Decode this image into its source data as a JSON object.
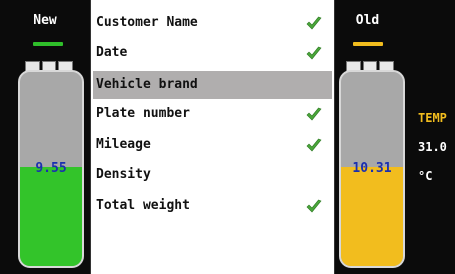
{
  "left_tank": {
    "title": "New",
    "value": "9.55",
    "level": 0.51,
    "fill_color": "#33c42a",
    "indicator_color": "#2fbf2a"
  },
  "right_tank": {
    "title": "Old",
    "value": "10.31",
    "level": 0.51,
    "fill_color": "#f2bd1e",
    "indicator_color": "#f2bd1e"
  },
  "list": {
    "items": [
      {
        "label": "Customer Name",
        "checked": true,
        "selected": false
      },
      {
        "label": "Date",
        "checked": true,
        "selected": false
      },
      {
        "label": "Vehicle brand",
        "checked": false,
        "selected": true
      },
      {
        "label": "Plate number",
        "checked": true,
        "selected": false
      },
      {
        "label": "Mileage",
        "checked": true,
        "selected": false
      },
      {
        "label": "Density",
        "checked": false,
        "selected": false
      },
      {
        "label": "Total weight",
        "checked": true,
        "selected": false
      }
    ]
  },
  "temperature": {
    "label": "TEMP",
    "value": "31.0",
    "unit": "°C"
  },
  "colors": {
    "check": "#4aa63a",
    "temp_label": "#f2bd1e",
    "text": "#ffffff"
  }
}
